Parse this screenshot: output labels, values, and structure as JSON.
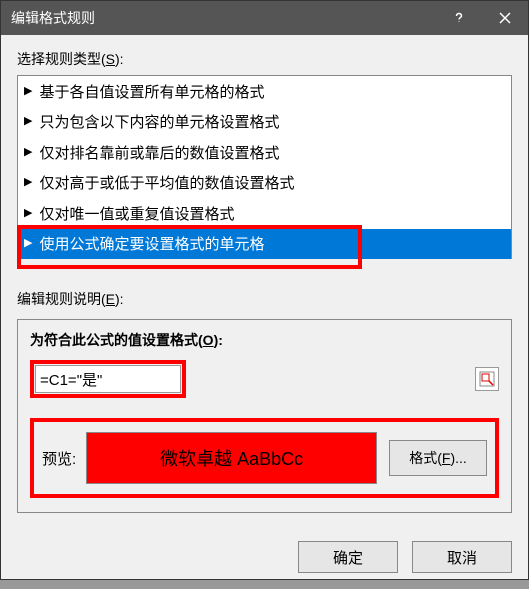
{
  "title": "编辑格式规则",
  "select_rule_type_label": "选择规则类型(S):",
  "rules": [
    "基于各自值设置所有单元格的格式",
    "只为包含以下内容的单元格设置格式",
    "仅对排名靠前或靠后的数值设置格式",
    "仅对高于或低于平均值的数值设置格式",
    "仅对唯一值或重复值设置格式",
    "使用公式确定要设置格式的单元格"
  ],
  "edit_rule_desc_label": "编辑规则说明(E):",
  "formula_label": "为符合此公式的值设置格式(O):",
  "formula_value": "=C1=\"是\"",
  "preview_label": "预览:",
  "preview_sample": "微软卓越 AaBbCc",
  "format_btn": "格式(F)...",
  "ok_btn": "确定",
  "cancel_btn": "取消"
}
